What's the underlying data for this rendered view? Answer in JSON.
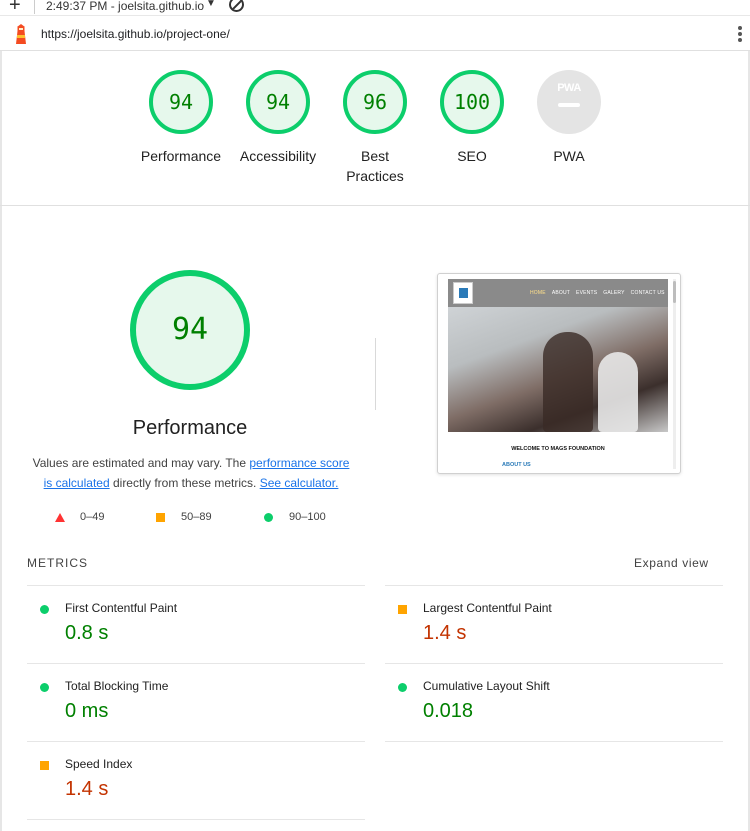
{
  "browser": {
    "tab_title": "2:49:37 PM - joelsita.github.io",
    "url": "https://joelsita.github.io/project-one/"
  },
  "summary": {
    "gauges": [
      {
        "label": "Performance",
        "score": "94"
      },
      {
        "label": "Accessibility",
        "score": "94"
      },
      {
        "label": "Best Practices",
        "score": "96"
      },
      {
        "label": "SEO",
        "score": "100"
      },
      {
        "label": "PWA",
        "score": ""
      }
    ],
    "pwa_badge": "PWA"
  },
  "performance": {
    "score": "94",
    "title": "Performance",
    "desc_prefix": "Values are estimated and may vary. The ",
    "desc_link1": "performance score is calculated",
    "desc_middle": " directly from these metrics. ",
    "desc_link2": "See calculator."
  },
  "screenshot": {
    "menu": [
      "HOME",
      "ABOUT",
      "EVENTS",
      "GALERY",
      "CONTACT US"
    ],
    "welcome": "WELCOME TO MAGS FOUNDATION",
    "about": "ABOUT US"
  },
  "legend": {
    "fail": "0–49",
    "average": "50–89",
    "pass": "90–100"
  },
  "metrics": {
    "heading": "METRICS",
    "expand": "Expand view",
    "items": [
      {
        "name": "First Contentful Paint",
        "value": "0.8 s",
        "rating": "pass"
      },
      {
        "name": "Largest Contentful Paint",
        "value": "1.4 s",
        "rating": "average"
      },
      {
        "name": "Total Blocking Time",
        "value": "0 ms",
        "rating": "pass"
      },
      {
        "name": "Cumulative Layout Shift",
        "value": "0.018",
        "rating": "pass"
      },
      {
        "name": "Speed Index",
        "value": "1.4 s",
        "rating": "average"
      }
    ]
  },
  "colors": {
    "pass": "#0cce6b",
    "pass_text": "#008000",
    "average": "#ffa400",
    "average_text": "#c33300",
    "fail": "#ff3333",
    "link": "#1a73e8"
  }
}
